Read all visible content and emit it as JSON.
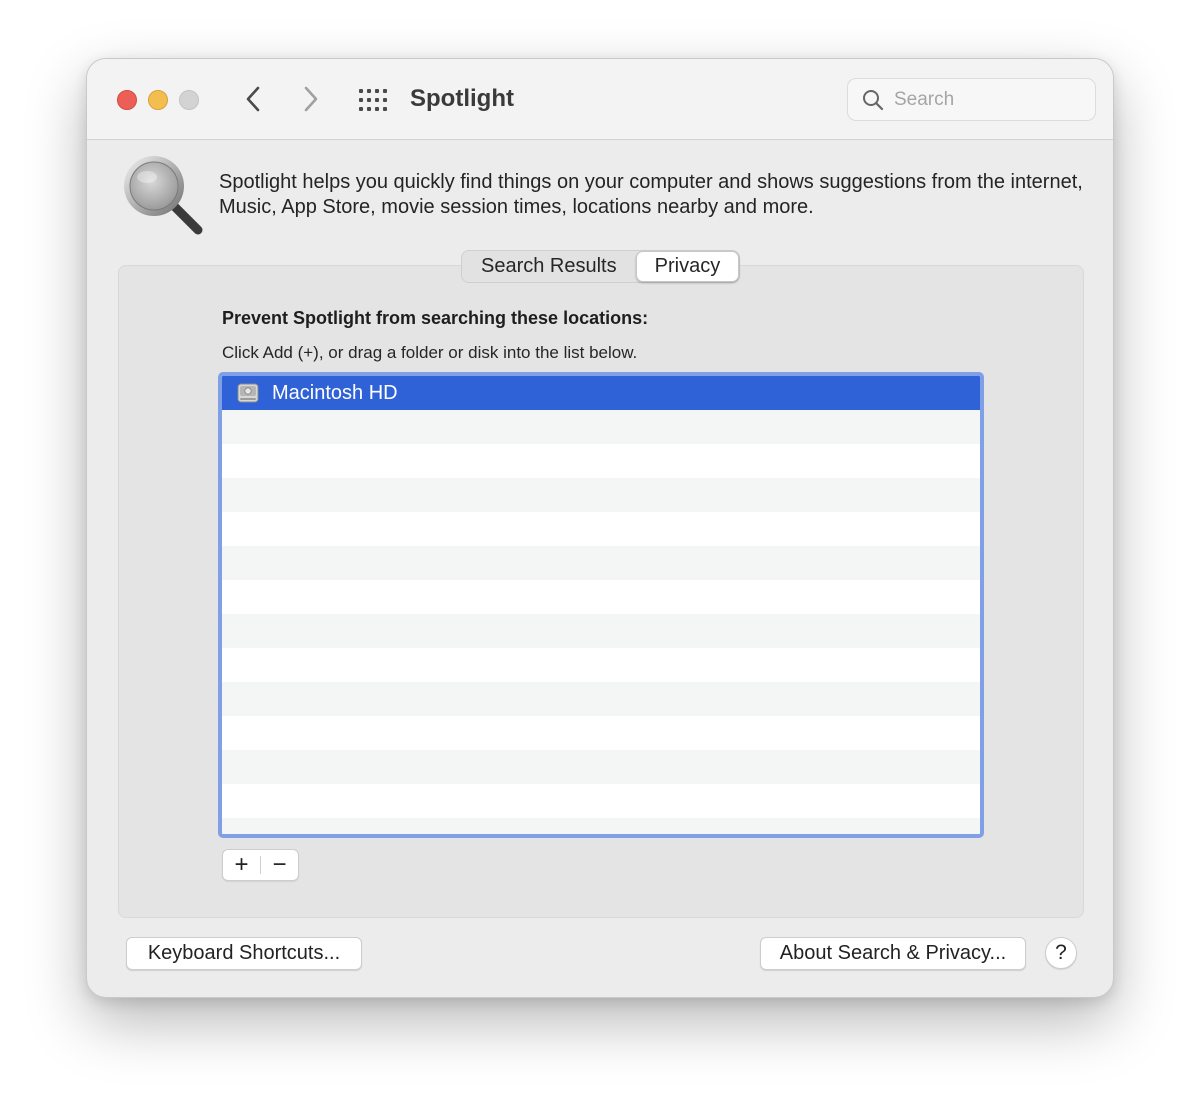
{
  "window": {
    "title": "Spotlight"
  },
  "search": {
    "placeholder": "Search",
    "value": ""
  },
  "intro": {
    "text": "Spotlight helps you quickly find things on your computer and shows suggestions from the internet, Music, App Store, movie session times, locations nearby and more."
  },
  "tabs": [
    {
      "label": "Search Results",
      "active": false
    },
    {
      "label": "Privacy",
      "active": true
    }
  ],
  "privacy": {
    "heading": "Prevent Spotlight from searching these locations:",
    "help": "Click Add (+), or drag a folder or disk into the list below.",
    "items": [
      {
        "label": "Macintosh HD",
        "icon": "hard-disk-icon",
        "selected": true
      }
    ]
  },
  "controls": {
    "add_label": "+",
    "remove_label": "−"
  },
  "footer": {
    "keyboard_shortcuts_label": "Keyboard Shortcuts...",
    "about_label": "About Search & Privacy...",
    "help_label": "?"
  },
  "colors": {
    "accent": "#2f62d6",
    "list_focus_ring": "#7fa0e6",
    "close": "#ec5f57",
    "minimize": "#f4bd4f"
  },
  "icons": [
    "back-chevron-icon",
    "forward-chevron-icon",
    "grid-icon",
    "search-icon",
    "magnifier-icon",
    "hard-disk-icon",
    "help-icon"
  ]
}
